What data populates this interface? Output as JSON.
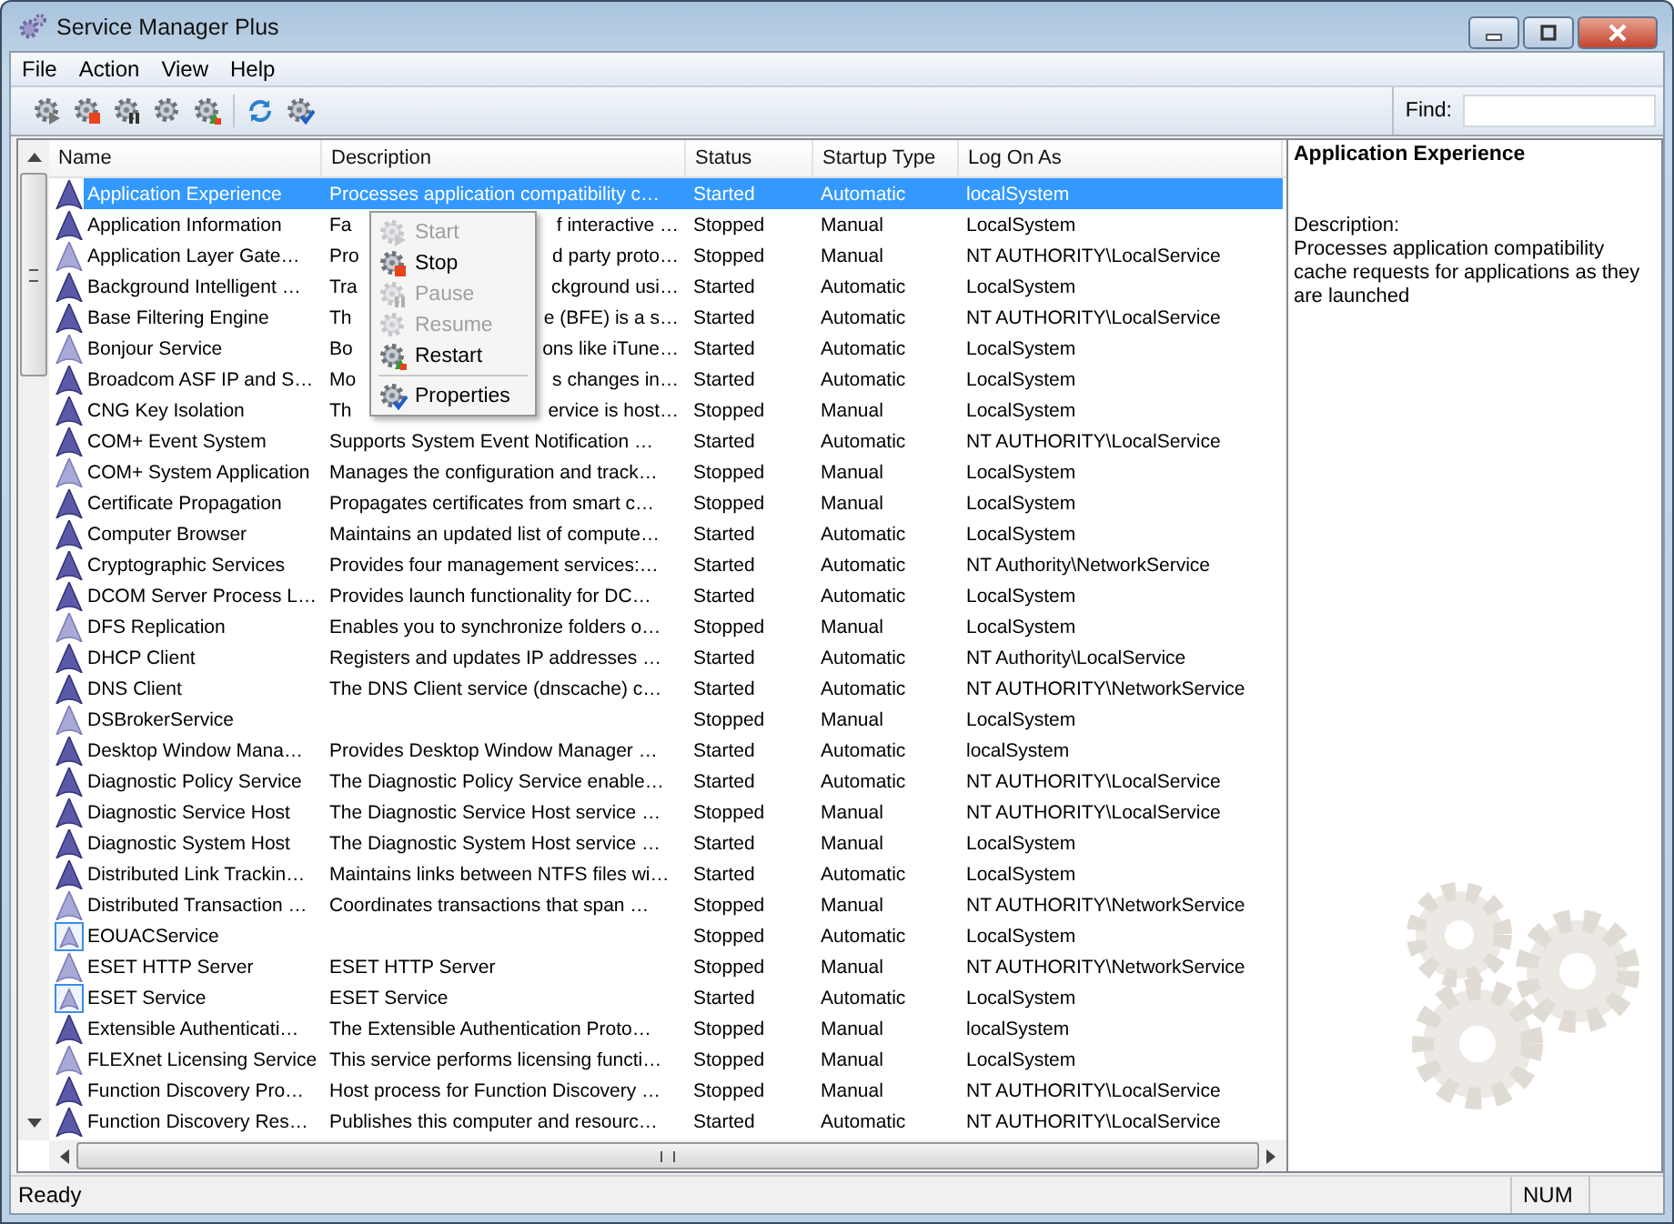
{
  "window": {
    "title": "Service Manager Plus"
  },
  "menu_bar": [
    "File",
    "Action",
    "View",
    "Help"
  ],
  "toolbar": [
    {
      "kind": "start"
    },
    {
      "kind": "stop"
    },
    {
      "kind": "pause"
    },
    {
      "kind": "resume"
    },
    {
      "kind": "restart"
    },
    {
      "kind": "refresh"
    },
    {
      "kind": "properties"
    }
  ],
  "find": {
    "label": "Find:"
  },
  "table": {
    "columns": [
      "Name",
      "Description",
      "Status",
      "Startup Type",
      "Log On As"
    ],
    "rows": [
      {
        "kind": "dark",
        "selected": true,
        "name": "Application Experience",
        "description": "Processes application compatibility c…",
        "status": "Started",
        "startup": "Automatic",
        "logon": "localSystem"
      },
      {
        "kind": "dark",
        "selected": false,
        "name": "Application Information",
        "description_parts": [
          "Fa",
          "f interactive …"
        ],
        "status": "Stopped",
        "startup": "Manual",
        "logon": "LocalSystem"
      },
      {
        "kind": "light",
        "selected": false,
        "name": "Application Layer Gate…",
        "description_parts": [
          "Pro",
          "d party proto…"
        ],
        "status": "Stopped",
        "startup": "Manual",
        "logon": "NT AUTHORITY\\LocalService"
      },
      {
        "kind": "dark",
        "selected": false,
        "name": "Background Intelligent …",
        "description_parts": [
          "Tra",
          "ckground usi…"
        ],
        "status": "Started",
        "startup": "Automatic",
        "logon": "LocalSystem"
      },
      {
        "kind": "dark",
        "selected": false,
        "name": "Base Filtering Engine",
        "description_parts": [
          "Th",
          "e (BFE) is a s…"
        ],
        "status": "Started",
        "startup": "Automatic",
        "logon": "NT AUTHORITY\\LocalService"
      },
      {
        "kind": "light",
        "selected": false,
        "name": "Bonjour Service",
        "description_parts": [
          "Bo",
          "ons like iTune…"
        ],
        "status": "Started",
        "startup": "Automatic",
        "logon": "LocalSystem"
      },
      {
        "kind": "dark",
        "selected": false,
        "name": "Broadcom ASF IP and S…",
        "description_parts": [
          "Mo",
          "s changes in…"
        ],
        "status": "Started",
        "startup": "Automatic",
        "logon": "LocalSystem"
      },
      {
        "kind": "dark",
        "selected": false,
        "name": "CNG Key Isolation",
        "description_parts": [
          "Th",
          "ervice is host…"
        ],
        "status": "Stopped",
        "startup": "Manual",
        "logon": "LocalSystem"
      },
      {
        "kind": "dark",
        "selected": false,
        "name": "COM+ Event System",
        "description": "Supports System Event Notification …",
        "status": "Started",
        "startup": "Automatic",
        "logon": "NT AUTHORITY\\LocalService"
      },
      {
        "kind": "light",
        "selected": false,
        "name": "COM+ System Application",
        "description": "Manages the configuration and track…",
        "status": "Stopped",
        "startup": "Manual",
        "logon": "LocalSystem"
      },
      {
        "kind": "dark",
        "selected": false,
        "name": "Certificate Propagation",
        "description": "Propagates certificates from smart c…",
        "status": "Stopped",
        "startup": "Manual",
        "logon": "LocalSystem"
      },
      {
        "kind": "dark",
        "selected": false,
        "name": "Computer Browser",
        "description": "Maintains an updated list of compute…",
        "status": "Started",
        "startup": "Automatic",
        "logon": "LocalSystem"
      },
      {
        "kind": "dark",
        "selected": false,
        "name": "Cryptographic Services",
        "description": "Provides four management services:…",
        "status": "Started",
        "startup": "Automatic",
        "logon": "NT Authority\\NetworkService"
      },
      {
        "kind": "dark",
        "selected": false,
        "name": "DCOM Server Process L…",
        "description": "Provides launch functionality for DC…",
        "status": "Started",
        "startup": "Automatic",
        "logon": "LocalSystem"
      },
      {
        "kind": "light",
        "selected": false,
        "name": "DFS Replication",
        "description": "Enables you to synchronize folders o…",
        "status": "Stopped",
        "startup": "Manual",
        "logon": "LocalSystem"
      },
      {
        "kind": "dark",
        "selected": false,
        "name": "DHCP Client",
        "description": "Registers and updates IP addresses …",
        "status": "Started",
        "startup": "Automatic",
        "logon": "NT Authority\\LocalService"
      },
      {
        "kind": "dark",
        "selected": false,
        "name": "DNS Client",
        "description": "The DNS Client service (dnscache) c…",
        "status": "Started",
        "startup": "Automatic",
        "logon": "NT AUTHORITY\\NetworkService"
      },
      {
        "kind": "light",
        "selected": false,
        "name": "DSBrokerService",
        "status": "Stopped",
        "startup": "Manual",
        "logon": "LocalSystem"
      },
      {
        "kind": "dark",
        "selected": false,
        "name": "Desktop Window Mana…",
        "description": "Provides Desktop Window Manager …",
        "status": "Started",
        "startup": "Automatic",
        "logon": "localSystem"
      },
      {
        "kind": "dark",
        "selected": false,
        "name": "Diagnostic Policy Service",
        "description": "The Diagnostic Policy Service enable…",
        "status": "Started",
        "startup": "Automatic",
        "logon": "NT AUTHORITY\\LocalService"
      },
      {
        "kind": "dark",
        "selected": false,
        "name": "Diagnostic Service Host",
        "description": "The Diagnostic Service Host service …",
        "status": "Stopped",
        "startup": "Manual",
        "logon": "NT AUTHORITY\\LocalService"
      },
      {
        "kind": "dark",
        "selected": false,
        "name": "Diagnostic System Host",
        "description": "The Diagnostic System Host service …",
        "status": "Started",
        "startup": "Manual",
        "logon": "LocalSystem"
      },
      {
        "kind": "dark",
        "selected": false,
        "name": "Distributed Link Trackin…",
        "description": "Maintains links between NTFS files wi…",
        "status": "Started",
        "startup": "Automatic",
        "logon": "LocalSystem"
      },
      {
        "kind": "light",
        "selected": false,
        "name": "Distributed Transaction …",
        "description": "Coordinates transactions that span …",
        "status": "Stopped",
        "startup": "Manual",
        "logon": "NT AUTHORITY\\NetworkService"
      },
      {
        "kind": "framed",
        "selected": false,
        "name": "EOUACService",
        "status": "Stopped",
        "startup": "Automatic",
        "logon": "LocalSystem"
      },
      {
        "kind": "light",
        "selected": false,
        "name": "ESET HTTP Server",
        "description": "ESET HTTP Server",
        "status": "Stopped",
        "startup": "Manual",
        "logon": "NT AUTHORITY\\NetworkService"
      },
      {
        "kind": "framed",
        "selected": false,
        "name": "ESET Service",
        "description": "ESET Service",
        "status": "Started",
        "startup": "Automatic",
        "logon": "LocalSystem"
      },
      {
        "kind": "dark",
        "selected": false,
        "name": "Extensible Authenticati…",
        "description": "The Extensible Authentication Proto…",
        "status": "Stopped",
        "startup": "Manual",
        "logon": "localSystem"
      },
      {
        "kind": "light",
        "selected": false,
        "name": "FLEXnet Licensing Service",
        "description": "This service performs licensing functi…",
        "status": "Stopped",
        "startup": "Manual",
        "logon": "LocalSystem"
      },
      {
        "kind": "dark",
        "selected": false,
        "name": "Function Discovery Pro…",
        "description": "Host process for Function Discovery …",
        "status": "Stopped",
        "startup": "Manual",
        "logon": "NT AUTHORITY\\LocalService"
      },
      {
        "kind": "dark",
        "selected": false,
        "name": "Function Discovery Res…",
        "description": "Publishes this computer and resourc…",
        "status": "Started",
        "startup": "Automatic",
        "logon": "NT AUTHORITY\\LocalService"
      }
    ]
  },
  "context_menu": {
    "items": [
      {
        "kind": "start",
        "label": "Start",
        "disabled": true
      },
      {
        "kind": "stop",
        "label": "Stop",
        "disabled": false
      },
      {
        "kind": "pause",
        "label": "Pause",
        "disabled": true
      },
      {
        "kind": "resume",
        "label": "Resume",
        "disabled": true
      },
      {
        "kind": "restart",
        "label": "Restart",
        "disabled": false
      },
      {
        "kind": "separator"
      },
      {
        "kind": "properties",
        "label": "Properties",
        "disabled": false
      }
    ]
  },
  "details": {
    "title": "Application Experience",
    "description_label": "Description:",
    "description": "Processes application compatibility cache requests for applications as they are launched"
  },
  "status_bar": {
    "text": "Ready",
    "indicator": "NUM"
  }
}
